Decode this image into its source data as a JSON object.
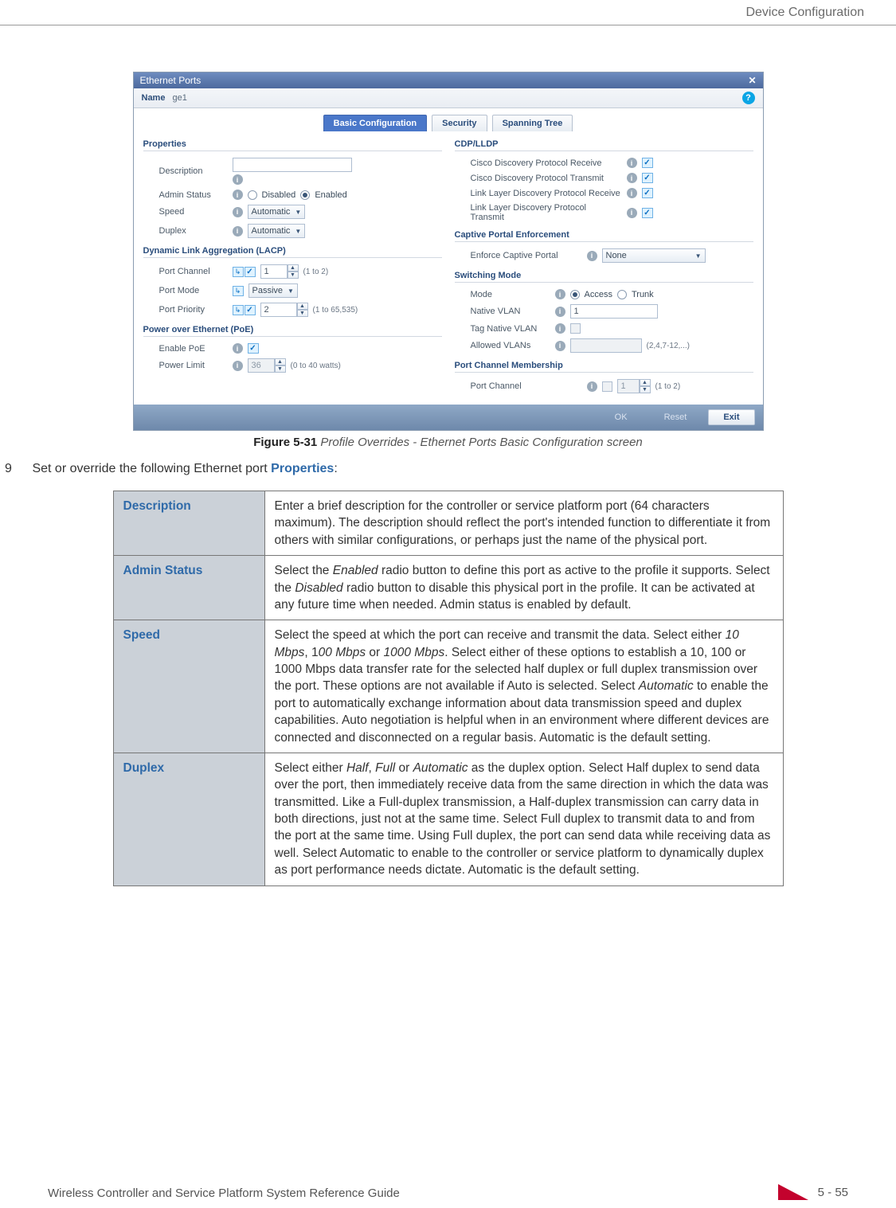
{
  "header_text": "Device Configuration",
  "footer_left": "Wireless Controller and Service Platform System Reference Guide",
  "footer_page": "5 - 55",
  "dialog": {
    "title": "Ethernet Ports",
    "name_label": "Name",
    "name_value": "ge1",
    "help_icon": "?",
    "tabs": {
      "basic": "Basic Configuration",
      "security": "Security",
      "spanning": "Spanning Tree"
    },
    "properties": {
      "heading": "Properties",
      "description_label": "Description",
      "admin_status_label": "Admin Status",
      "admin_disabled": "Disabled",
      "admin_enabled": "Enabled",
      "speed_label": "Speed",
      "speed_value": "Automatic",
      "duplex_label": "Duplex",
      "duplex_value": "Automatic"
    },
    "lacp": {
      "heading": "Dynamic Link Aggregation (LACP)",
      "port_channel_label": "Port Channel",
      "port_channel_value": "1",
      "port_channel_range": "(1 to 2)",
      "port_mode_label": "Port Mode",
      "port_mode_value": "Passive",
      "port_priority_label": "Port Priority",
      "port_priority_value": "2",
      "port_priority_range": "(1 to 65,535)"
    },
    "poe": {
      "heading": "Power over Ethernet (PoE)",
      "enable_label": "Enable PoE",
      "limit_label": "Power Limit",
      "limit_value": "36",
      "limit_range": "(0 to 40 watts)"
    },
    "cdp": {
      "heading": "CDP/LLDP",
      "cdpr": "Cisco Discovery Protocol Receive",
      "cdpt": "Cisco Discovery Protocol Transmit",
      "lldpr": "Link Layer Discovery Protocol Receive",
      "lldpt": "Link Layer Discovery Protocol Transmit"
    },
    "captive": {
      "heading": "Captive Portal Enforcement",
      "enforce_label": "Enforce Captive Portal",
      "enforce_value": "None"
    },
    "switch": {
      "heading": "Switching Mode",
      "mode_label": "Mode",
      "mode_access": "Access",
      "mode_trunk": "Trunk",
      "native_vlan_label": "Native VLAN",
      "native_vlan_value": "1",
      "tag_native_label": "Tag Native VLAN",
      "allowed_label": "Allowed VLANs",
      "allowed_hint": "(2,4,7-12,...)"
    },
    "portchan": {
      "heading": "Port Channel Membership",
      "label": "Port Channel",
      "value": "1",
      "range": "(1 to 2)"
    },
    "buttons": {
      "ok": "OK",
      "reset": "Reset",
      "exit": "Exit"
    }
  },
  "caption": {
    "strong": "Figure 5-31",
    "rest": "Profile Overrides - Ethernet Ports Basic Configuration screen"
  },
  "step": {
    "num": "9",
    "pre": "Set or override the following Ethernet port ",
    "kw": "Properties",
    "post": ":"
  },
  "table": {
    "description": {
      "h": "Description",
      "t": "Enter a brief description for the controller or service platform port (64 characters maximum). The description should reflect the port's intended function to differentiate it from others with similar configurations, or perhaps just the name of the physical port."
    },
    "admin": {
      "h": "Admin Status",
      "t1": "Select the ",
      "i1": "Enabled",
      "t2": " radio button to define this port as active to the profile it supports. Select the ",
      "i2": "Disabled",
      "t3": " radio button to disable this physical port in the profile. It can be activated at any future time when needed. Admin status is enabled by default."
    },
    "speed": {
      "h": "Speed",
      "t1": "Select the speed at which the port can receive and transmit the data. Select either ",
      "i1": "10 Mbps",
      "t2": ", 1",
      "i2": "00 Mbps",
      "t3": " or ",
      "i3": "1000 Mbps",
      "t4": ". Select either of these options to establish a 10, 100 or 1000 Mbps data transfer rate for the selected half duplex or full duplex transmission over the port. These options are not available if Auto is selected. Select ",
      "i4": "Automatic",
      "t5": " to enable the port to automatically exchange information about data transmission speed and duplex capabilities. Auto negotiation is helpful when in an environment where different devices are connected and disconnected on a regular basis. Automatic is the default setting."
    },
    "duplex": {
      "h": "Duplex",
      "t1": "Select either ",
      "i1": "Half",
      "t2": ", ",
      "i2": "Full",
      "t3": " or ",
      "i3": "Automatic",
      "t4": " as the duplex option. Select Half duplex to send data over the port, then immediately receive data from the same direction in which the data was transmitted. Like a Full-duplex transmission, a Half-duplex transmission can carry data in both directions, just not at the same time. Select Full duplex to transmit data to and from the port at the same time. Using Full duplex, the port can send data while receiving data as well. Select Automatic to enable to the controller or service platform to dynamically duplex as port performance needs dictate. Automatic is the default setting."
    }
  }
}
